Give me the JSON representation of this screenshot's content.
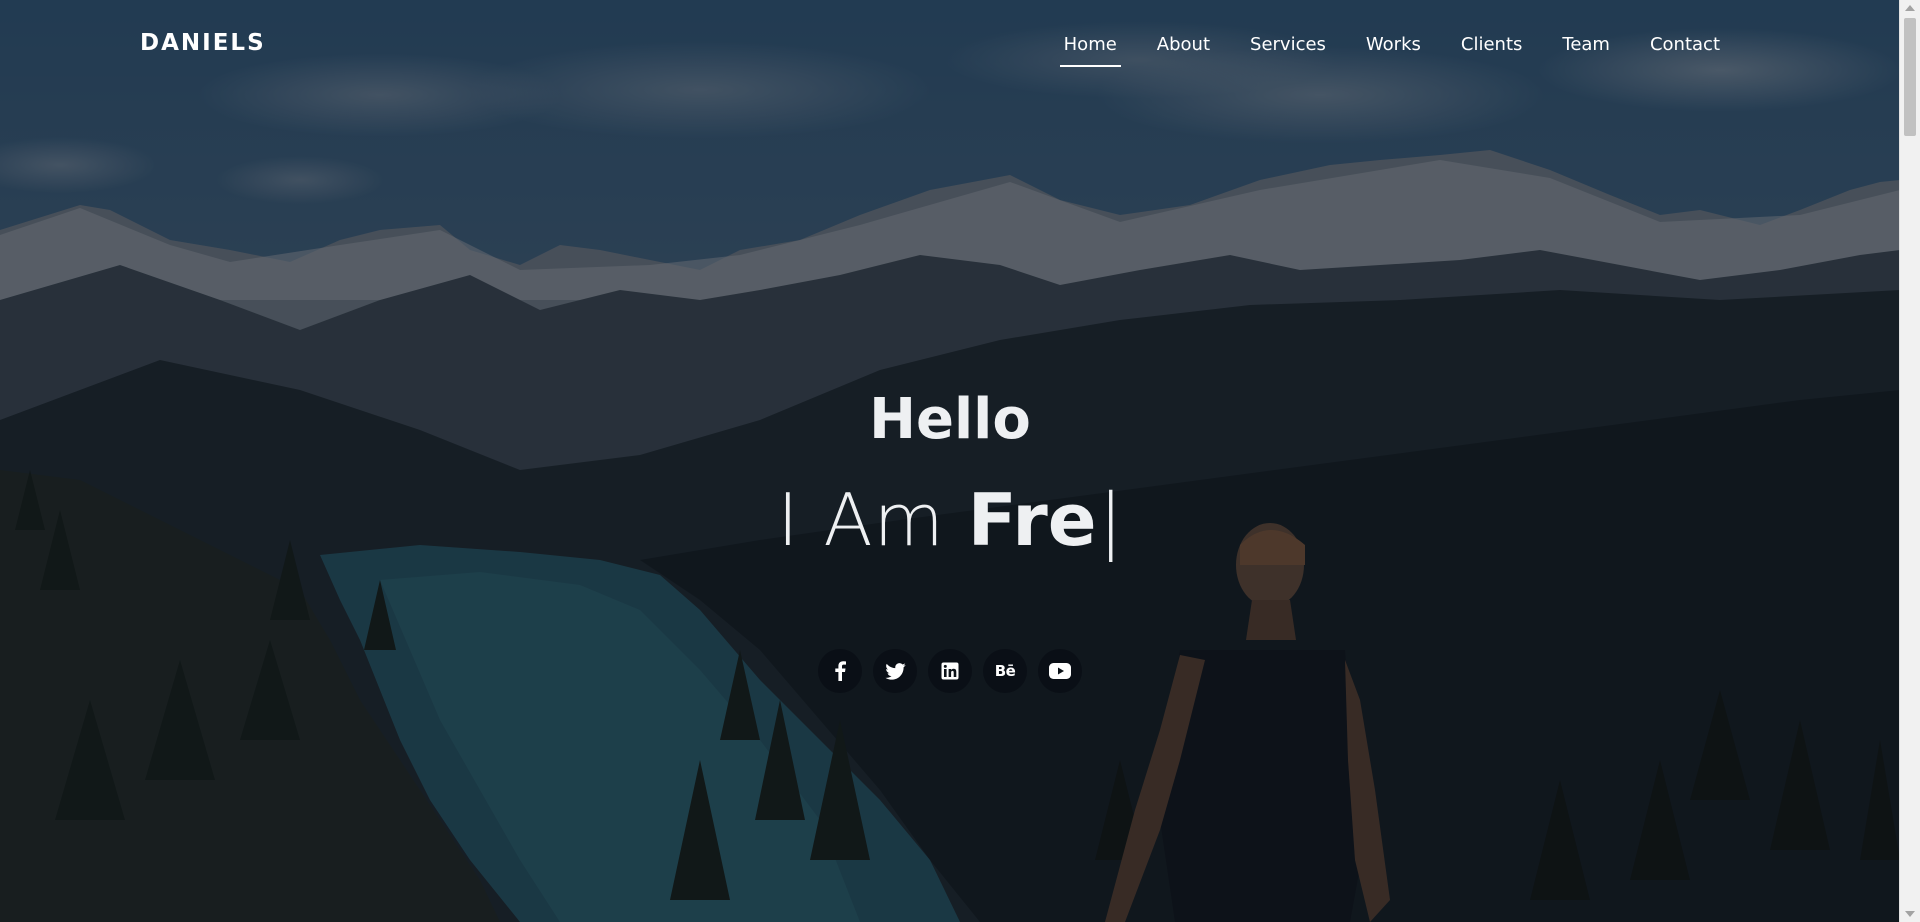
{
  "brand": {
    "logo": "DANIELS"
  },
  "nav": {
    "items": [
      {
        "label": "Home",
        "active": true
      },
      {
        "label": "About"
      },
      {
        "label": "Services"
      },
      {
        "label": "Works"
      },
      {
        "label": "Clients"
      },
      {
        "label": "Team"
      },
      {
        "label": "Contact"
      }
    ]
  },
  "hero": {
    "greeting": "Hello",
    "prefix": "I Am",
    "typed_text": "Fre",
    "cursor": "|",
    "background": "mountain lake landscape with hiker"
  },
  "social": [
    {
      "icon": "facebook-icon",
      "label": "f"
    },
    {
      "icon": "twitter-icon"
    },
    {
      "icon": "linkedin-icon"
    },
    {
      "icon": "behance-icon",
      "label": "Bē"
    },
    {
      "icon": "youtube-icon"
    }
  ],
  "colors": {
    "text": "#ffffff",
    "overlay": "rgba(8,12,18,0.52)"
  }
}
